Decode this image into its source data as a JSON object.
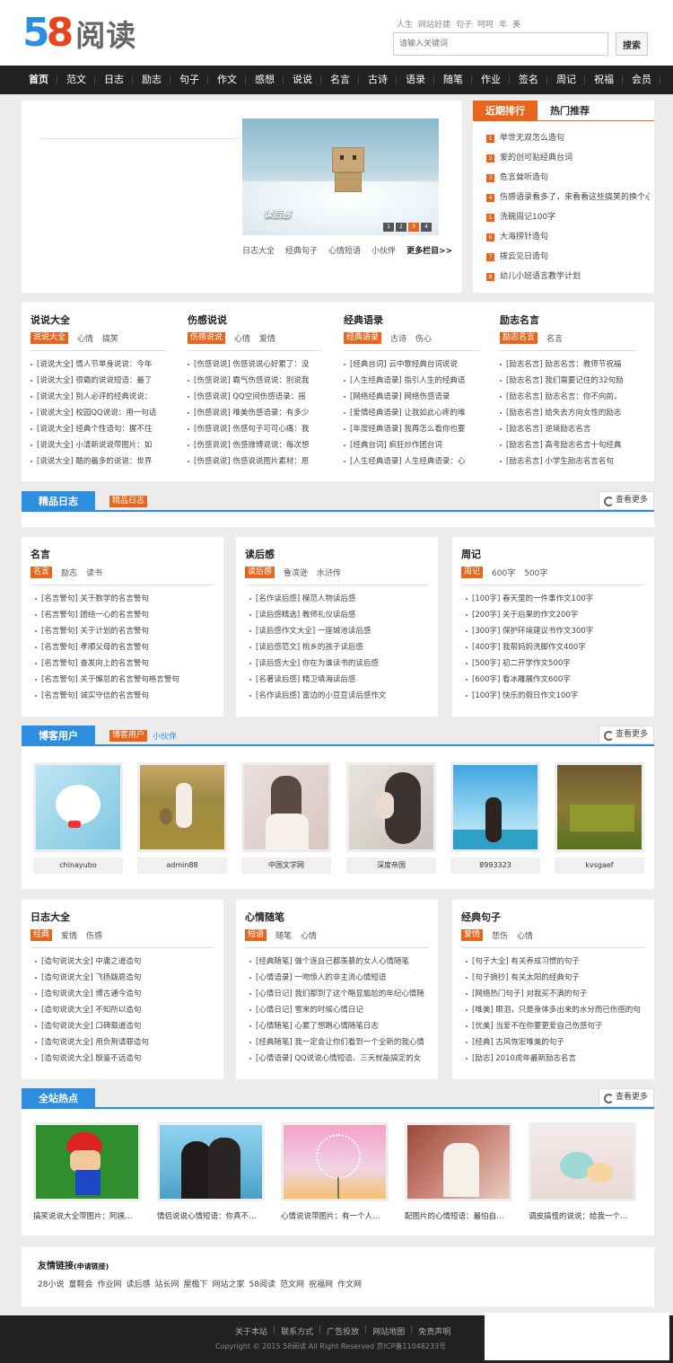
{
  "header": {
    "logo_num5": "5",
    "logo_num8": "8",
    "logo_text": "阅读",
    "hotwords": [
      "人生",
      "网站好建",
      "句子",
      "呵呵",
      "年",
      "美"
    ],
    "search_placeholder": "请输入关键词",
    "search_button": "搜索"
  },
  "nav": [
    "首页",
    "范文",
    "日志",
    "励志",
    "句子",
    "作文",
    "感想",
    "说说",
    "名言",
    "古诗",
    "语录",
    "随笔",
    "作业",
    "签名",
    "周记",
    "祝福",
    "会员"
  ],
  "slider": {
    "caption": "读后感",
    "dots": [
      "1",
      "2",
      "3",
      "4"
    ],
    "links": [
      "日志大全",
      "经典句子",
      "心情短语",
      "小伙伴"
    ],
    "more": "更多栏目>>"
  },
  "rank": {
    "tabs": [
      "近期排行",
      "热门推荐"
    ],
    "items": [
      "举世无双怎么造句",
      "爱的创可贴经典台词",
      "危言耸听造句",
      "伤感语录看多了，来看看这些搞笑的换个心",
      "洗碗周记100字",
      "大海捞针造句",
      "拨云见日造句",
      "幼儿小班语言教学计划"
    ]
  },
  "cats": [
    {
      "title": "说说大全",
      "tags": [
        "说说大全",
        "心情",
        "搞笑"
      ],
      "items": [
        "[说说大全] 情人节单身说说：今年",
        "[说说大全] 很霸的说说短语：最了",
        "[说说大全] 别人必评的经典说说：",
        "[说说大全] 校园QQ说说：用一句话",
        "[说说大全] 经典个性语句：握不住",
        "[说说大全] 小清新说说带图片：如",
        "[说说大全] 酷的最多的说说：世界"
      ]
    },
    {
      "title": "伤感说说",
      "tags": [
        "伤感说说",
        "心情",
        "爱情"
      ],
      "items": [
        "[伤感说说] 伤感说说心好累了：没",
        "[伤感说说] 霸气伤感说说：别说我",
        "[伤感说说] QQ空间伤感语录：摇",
        "[伤感说说] 唯美伤感语录：有多少",
        "[伤感说说] 伤感句子可可心痛：我",
        "[伤感说说] 伤感微博说说：每次想",
        "[伤感说说] 伤感说说图片素材：愿"
      ]
    },
    {
      "title": "经典语录",
      "tags": [
        "经典语录",
        "古诗",
        "伤心"
      ],
      "items": [
        "[经典台词] 云中歌经典台词说说",
        "[人生经典语录] 指引人生的经典语",
        "[网络经典语录] 网络伤感语录",
        "[爱情经典语录] 让我如此心疼的唯",
        "[年度经典语录] 我再怎么看你也要",
        "[经典台词] 疯狂炒作团台词",
        "[人生经典语录] 人生经典语录：心"
      ]
    },
    {
      "title": "励志名言",
      "tags": [
        "励志名言",
        "名言"
      ],
      "items": [
        "[励志名言] 励志名言：教师节祝福",
        "[励志名言] 我们需要记住的32句励",
        "[励志名言] 励志名言：你不向前，",
        "[励志名言] 给失去方向女性的励志",
        "[励志名言] 逆境励志名言",
        "[励志名言] 高考励志名言十句经典",
        "[励志名言] 小学生励志名言名句"
      ]
    }
  ],
  "sec1": {
    "title": "精品日志",
    "tag_on": "精品日志",
    "more": "查看更多"
  },
  "mid1": [
    {
      "title": "名言",
      "tags": [
        "名言",
        "励志",
        "读书"
      ],
      "items": [
        "[名言警句] 关于数学的名言警句",
        "[名言警句] 团结一心的名言警句",
        "[名言警句] 关于计划的名言警句",
        "[名言警句] 孝顺父母的名言警句",
        "[名言警句] 奋发向上的名言警句",
        "[名言警句] 关于懈怠的名言警句格言警句",
        "[名言警句] 诚实守信的名言警句"
      ]
    },
    {
      "title": "读后感",
      "tags": [
        "读后感",
        "鲁滨逊",
        "水浒传"
      ],
      "items": [
        "[名作读后感] 模范人物读后感",
        "[读后感精选] 教师礼仪读后感",
        "[读后感作文大全] 一座城池读后感",
        "[读后感范文] 桃乡的孩子读后感",
        "[读后感大全] 你在为谁读书的读后感",
        "[名著读后感] 精卫填海读后感",
        "[名作读后感] 富边的小豆豆读后感作文"
      ]
    },
    {
      "title": "周记",
      "tags": [
        "周记",
        "600字",
        "500字"
      ],
      "items": [
        "[100字] 春天里的一件事作文100字",
        "[200字] 关于后果的作文200字",
        "[300字] 保护环境建议书作文300字",
        "[400字] 我帮妈妈洗脚作文400字",
        "[500字] 初二开学作文500字",
        "[600字] 看冰雕展作文600字",
        "[100字] 快乐的假日作文100字"
      ]
    }
  ],
  "sec2": {
    "title": "博客用户",
    "tag_on": "博客用户",
    "tag": "小伙伴",
    "more": "查看更多"
  },
  "users": [
    "chinayubo",
    "admin88",
    "中国文学网",
    "深度帝国",
    "8993323",
    "kvsgaef"
  ],
  "mid2": [
    {
      "title": "日志大全",
      "tags": [
        "经典",
        "爱情",
        "伤感"
      ],
      "items": [
        "[造句说说大全] 中庸之道造句",
        "[造句说说大全] 飞扬跋扈造句",
        "[造句说说大全] 博古通今造句",
        "[造句说说大全] 不知所以造句",
        "[造句说说大全] 口碑载道造句",
        "[造句说说大全] 用负荆请罪造句",
        "[造句说说大全] 殷鉴不远造句"
      ]
    },
    {
      "title": "心情随笔",
      "tags": [
        "短语",
        "随笔",
        "心情"
      ],
      "items": [
        "[经典随笔] 做个连自己都羡慕的女人心情随笔",
        "[心情语录] 一吻惊人的非主流心情短语",
        "[心情日记] 我们都到了这个略显尴尬的年纪心情随",
        "[心情日记] 雪来的时候心情日记",
        "[心情随笔] 心累了想跑心情随笔日志",
        "[经典随笔] 我一定会让你们看到一个全新的我心情",
        "[心情语录] QQ说说心情短语、三天就能搞定的女"
      ]
    },
    {
      "title": "经典句子",
      "tags": [
        "爱情",
        "悲伤",
        "心情"
      ],
      "items": [
        "[句子大全] 有关养成习惯的句子",
        "[句子摘抄] 有关太阳的经典句子",
        "[网络热门句子] 对我买不满的句子",
        "[唯美] 眼泪，只是身体多出来的水分而已伤感的句",
        "[优美] 当爱不在你要更爱自己伤感句子",
        "[经典] 古风恢宏唯美的句子",
        "[励志] 2010虎年最新励志名言"
      ]
    }
  ],
  "sec3": {
    "title": "全站热点",
    "more": "查看更多"
  },
  "hot": [
    "搞笑说说大全带图片：阿姨…",
    "情侣说说心情短语：你真不…",
    "心情说说带图片：有一个人…",
    "配图片的心情短语：最怕自…",
    "调皮搞怪的说说：给我一个…"
  ],
  "links": {
    "title": "友情链接",
    "sub": "(申请链接)",
    "items": [
      "28小说",
      "童鞋会",
      "作业网",
      "读后感",
      "站长网",
      "屋檐下",
      "网站之家",
      "58阅读",
      "范文网",
      "祝福网",
      "作文网"
    ]
  },
  "footer": {
    "nav": [
      "关于本站",
      "联系方式",
      "广告投放",
      "网站地图",
      "免责声明"
    ],
    "copyright": "Copyright © 2015 58阅读 All Right Reserved 京ICP备11048233号"
  }
}
